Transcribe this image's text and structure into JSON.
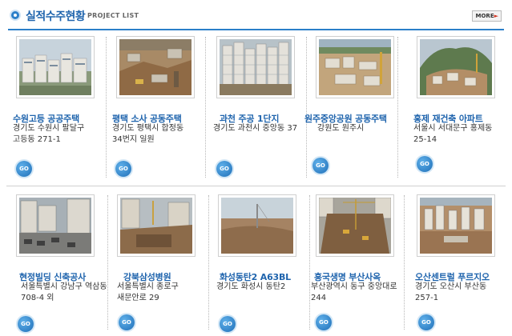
{
  "header": {
    "title": "실적수주현황",
    "subtitle": "PROJECT LIST",
    "more_label": "MORE",
    "more_arrow": "►"
  },
  "colors": {
    "accent": "#1f64ad",
    "rule": "#2b7fc9",
    "text": "#333333"
  },
  "projects": [
    {
      "name": "수원고등 공공주택",
      "address": "경기도 수원시 팔달구 고등동 271-1",
      "go_label": "GO",
      "photo": "apartment-complex"
    },
    {
      "name": "평택 소사 공동주택",
      "address": "경기도 평택시 합정동 34번지 일원",
      "go_label": "GO",
      "photo": "excavation-site"
    },
    {
      "name": "과천 주공 1단지",
      "address": "경기도 과천시 중앙동 37",
      "go_label": "GO",
      "photo": "highrise-towers"
    },
    {
      "name": "원주중앙공원 공동주택",
      "address": "강원도 원주시",
      "go_label": "GO",
      "photo": "foundation-site"
    },
    {
      "name": "홍제 재건축 아파트",
      "address": "서울시 서대문구 홍제동 25-14",
      "go_label": "GO",
      "photo": "hillside-site"
    },
    {
      "name": "현정빌딩 신축공사",
      "address": "서울특별시 강남구 역삼동 708-4 외",
      "go_label": "GO",
      "photo": "urban-lot"
    },
    {
      "name": "강북삼성병원",
      "address": "서울특별시 종로구 새문안로 29",
      "go_label": "GO",
      "photo": "hospital-site"
    },
    {
      "name": "화성동탄2 A63BL",
      "address": "경기도 화성시 동탄2",
      "go_label": "GO",
      "photo": "open-field"
    },
    {
      "name": "흥국생명 부산사옥",
      "address": "부산광역시 동구 중앙대로 244",
      "go_label": "GO",
      "photo": "deep-excavation"
    },
    {
      "name": "오산센트럴 푸르지오",
      "address": "경기도 오산시 부산동 257-1",
      "go_label": "GO",
      "photo": "aerial-complex"
    }
  ]
}
